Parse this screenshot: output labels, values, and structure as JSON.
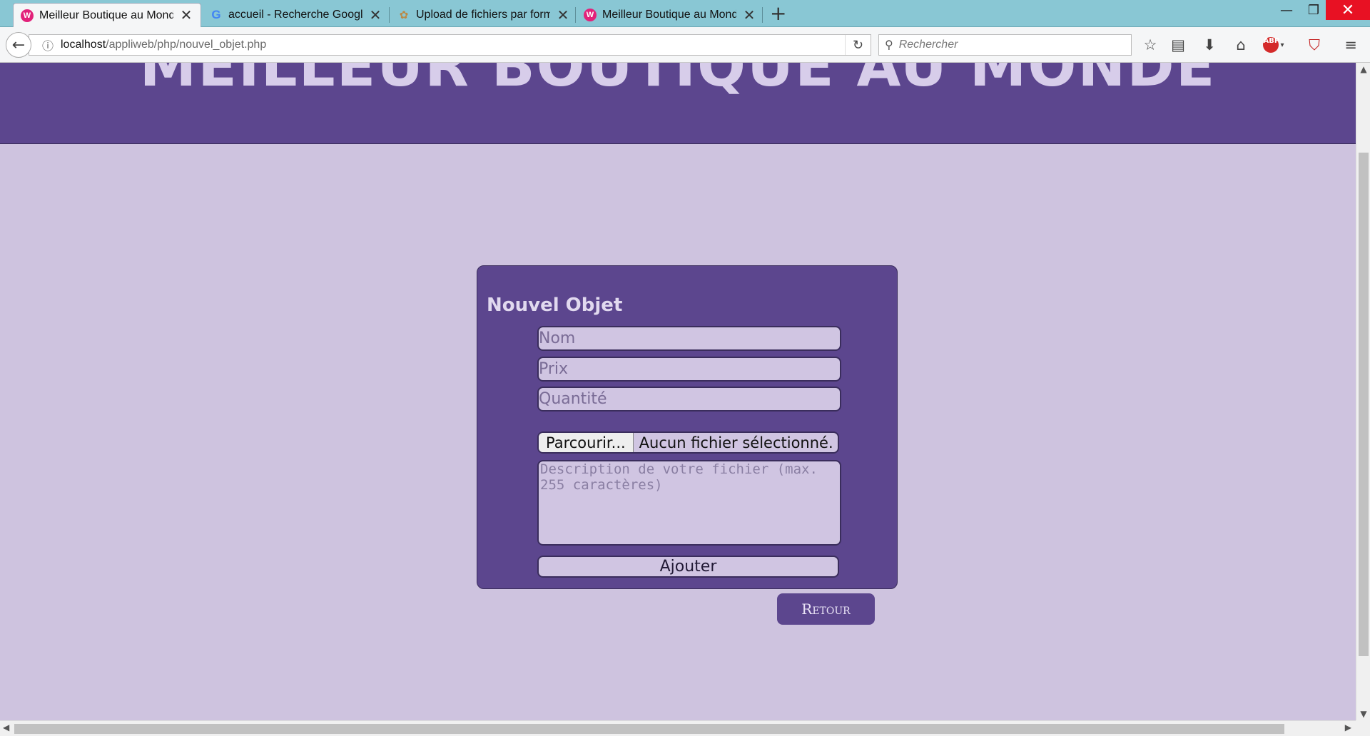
{
  "browser": {
    "tabs": [
      {
        "title": "Meilleur Boutique au Monde",
        "favicon": "wamp-icon",
        "active": true
      },
      {
        "title": "accueil - Recherche Google",
        "favicon": "google-icon",
        "active": false
      },
      {
        "title": "Upload de fichiers par formulaire",
        "favicon": "openclassrooms-icon",
        "active": false
      },
      {
        "title": "Meilleur Boutique au Monde",
        "favicon": "wamp-icon",
        "active": false
      }
    ],
    "url_host": "localhost",
    "url_path": "/appliweb/php/nouvel_objet.php",
    "search_placeholder": "Rechercher",
    "window_controls": {
      "minimize": "—",
      "maximize": "❐",
      "close": "✕"
    },
    "toolbar_icons": [
      "bookmark-star-icon",
      "reading-list-icon",
      "download-icon",
      "home-icon",
      "adblock-plus-icon",
      "ublock-icon",
      "menu-icon"
    ]
  },
  "page": {
    "site_title": "MEILLEUR BOUTIQUE AU MONDE",
    "form": {
      "title": "Nouvel Objet",
      "name_placeholder": "Nom",
      "price_placeholder": "Prix",
      "quantity_placeholder": "Quantité",
      "file_button": "Parcourir...",
      "file_status": "Aucun fichier sélectionné.",
      "description_placeholder": "Description de votre fichier (max. 255 caractères)",
      "submit_label": "Ajouter"
    },
    "back_label": "Retour"
  },
  "colors": {
    "background": "#cec3df",
    "header": "#5c468e",
    "header_text": "#d7cdea",
    "input_bg": "#d0c5e2"
  }
}
